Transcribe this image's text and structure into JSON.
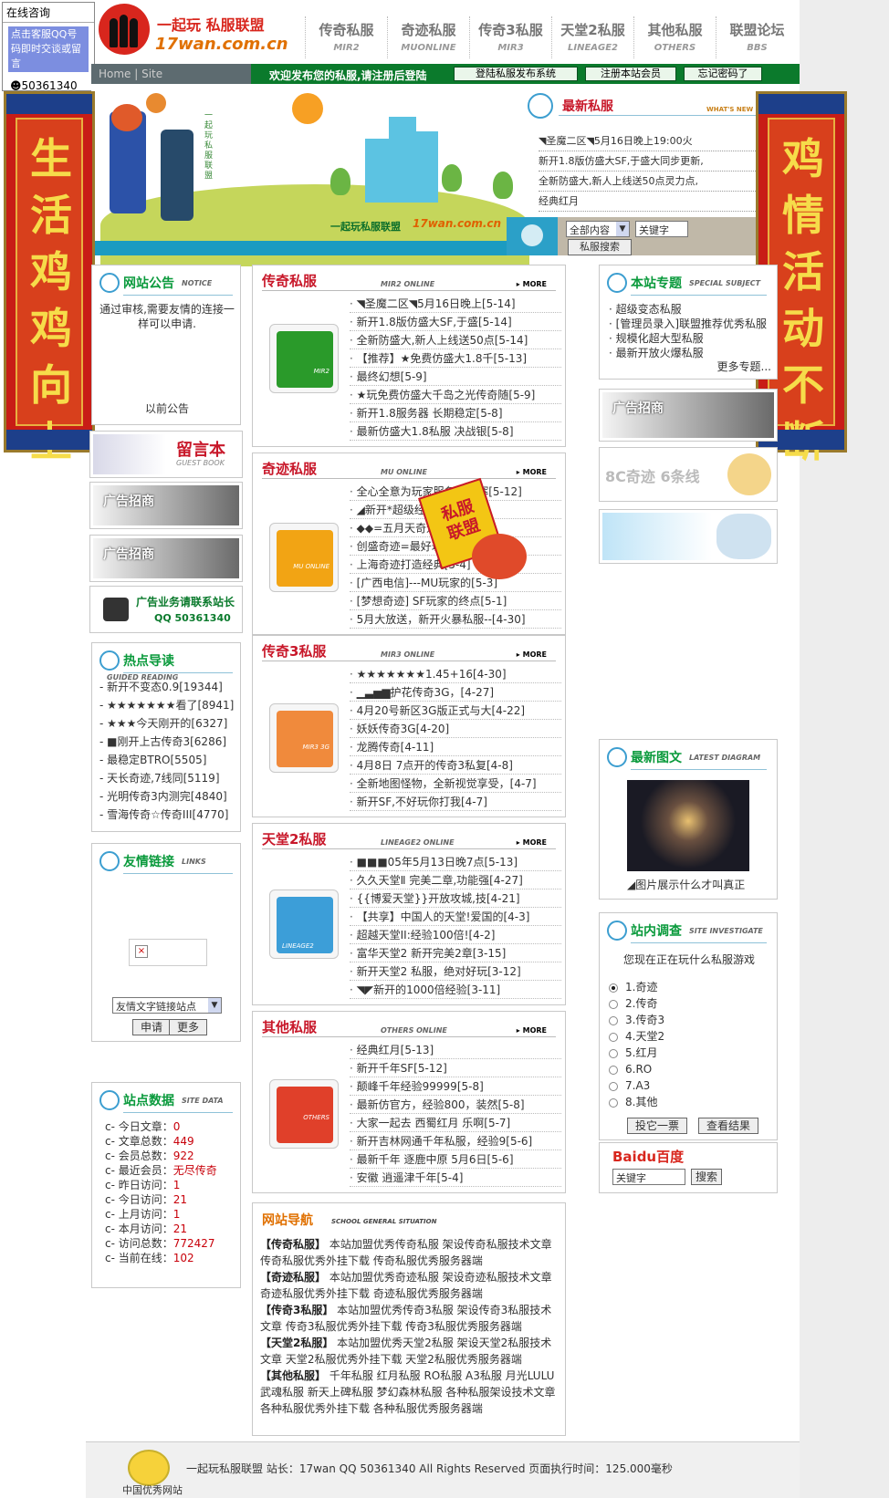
{
  "qq_box": {
    "title": "在线咨询",
    "button": "点击客服QQ号码即时交谈或留言",
    "qq": "50361340"
  },
  "header": {
    "logo_text": "一起玩 私服联盟",
    "logo_url": "17wan.com.cn"
  },
  "topnav": [
    {
      "cn": "传奇私服",
      "en": "MIR2"
    },
    {
      "cn": "奇迹私服",
      "en": "MUONLINE"
    },
    {
      "cn": "传奇3私服",
      "en": "MIR3"
    },
    {
      "cn": "天堂2私服",
      "en": "LINEAGE2"
    },
    {
      "cn": "其他私服",
      "en": "OTHERS"
    },
    {
      "cn": "联盟论坛",
      "en": "BBS"
    }
  ],
  "bar": {
    "home": "Home | Site",
    "welcome": "欢迎发布您的私服,请注册后登陆",
    "btn1": "登陆私服发布系统",
    "btn2": "注册本站会员",
    "btn3": "忘记密码了"
  },
  "banner": {
    "caption": "一起玩私服联盟",
    "url": "17wan.com.cn",
    "side_text": "一起玩私服联盟"
  },
  "latest": {
    "title": "最新私服",
    "en": "WHAT'S NEW",
    "items": [
      "◥圣魔二区◥5月16日晚上19:00火",
      "新开1.8版仿盛大SF,于盛大同步更新,",
      "全新防盛大,新人上线送50点灵力点,",
      "经典红月"
    ]
  },
  "search": {
    "select": "全部内容",
    "input": "关键字",
    "button": "私服搜索"
  },
  "couplet_left": "生活鸡鸡向上",
  "couplet_right": "鸡情活动不断",
  "notice": {
    "title": "网站公告",
    "en": "NOTICE",
    "text": "通过审核,需要友情的连接一样可以申请.",
    "more": "以前公告"
  },
  "guestbook": {
    "title": "留言本",
    "en": "GUEST BOOK"
  },
  "ad_text": "广告招商",
  "ad_contact": {
    "line1": "广告业务请联系站长",
    "line2": "QQ 50361340"
  },
  "hot": {
    "title": "热点导读",
    "en": "GUIDED READING",
    "items": [
      "- 新开不变态0.9[19344]",
      "- ★★★★★★★看了[8941]",
      "- ★★★今天刚开的[6327]",
      "- ■刚开上古传奇3[6286]",
      "- 最稳定BTRO[5505]",
      "- 天长奇迹,7线同[5119]",
      "- 光明传奇3内测完[4840]",
      "- 雪海传奇☆传奇III[4770]"
    ]
  },
  "links": {
    "title": "友情链接",
    "en": "LINKS",
    "select": "友情文字链接站点",
    "btn1": "申请",
    "btn2": "更多"
  },
  "stats": {
    "title": "站点数据",
    "en": "SITE DATA",
    "items": [
      {
        "k": "c- 今日文章：",
        "v": "0"
      },
      {
        "k": "c- 文章总数：",
        "v": "449"
      },
      {
        "k": "c- 会员总数：",
        "v": "922"
      },
      {
        "k": "c- 最近会员：",
        "v": "无尽传奇"
      },
      {
        "k": "c- 昨日访问：",
        "v": "1"
      },
      {
        "k": "c- 今日访问：",
        "v": "21"
      },
      {
        "k": "c- 上月访问：",
        "v": "1"
      },
      {
        "k": "c- 本月访问：",
        "v": "21"
      },
      {
        "k": "c- 访问总数：",
        "v": "772427"
      },
      {
        "k": "c- 当前在线：",
        "v": "102"
      }
    ]
  },
  "sections": [
    {
      "cn": "传奇私服",
      "en": "MIR2 ONLINE",
      "more": "MORE",
      "thumb_label": "MIR2",
      "items": [
        "◥圣魔二区◥5月16日晚上[5-14]",
        "新开1.8版仿盛大SF,于盛[5-14]",
        "全新防盛大,新人上线送50点[5-14]",
        "【推荐】★免费仿盛大1.8千[5-13]",
        "最终幻想[5-9]",
        "★玩免费仿盛大千岛之光传奇随[5-9]",
        "新开1.8服务器 长期稳定[5-8]",
        "最新仿盛大1.8私服 决战银[5-8]"
      ]
    },
    {
      "cn": "奇迹私服",
      "en": "MU ONLINE",
      "more": "MORE",
      "thumb_label": "MU ONLINE",
      "items": [
        "全心全意为玩家服务SF=辉[5-12]",
        "◢新开*超级经典[5-11]",
        "◆◆=五月天奇迹开区[5-11]",
        "创盛奇迹=最好玩的奇迹[5-10]",
        "上海奇迹打造经典[5-4]",
        "[广西电信]---MU玩家的[5-3]",
        "[梦想奇迹] SF玩家的终点[5-1]",
        "5月大放送，新开火暴私服--[4-30]"
      ]
    },
    {
      "cn": "传奇3私服",
      "en": "MIR3 ONLINE",
      "more": "MORE",
      "thumb_label": "MIR3 3G",
      "items": [
        "★★★★★★★1.45+16[4-30]",
        "▁▃▅▆护花传奇3G，[4-27]",
        "4月20号新区3G版正式与大[4-22]",
        "妖妖传奇3G[4-20]",
        "龙腾传奇[4-11]",
        "4月8日 7点开的传奇3私复[4-8]",
        "全新地图怪物，全新视觉享受，[4-7]",
        "新开SF,不好玩你打我[4-7]"
      ]
    },
    {
      "cn": "天堂2私服",
      "en": "LINEAGE2 ONLINE",
      "more": "MORE",
      "thumb_label": "LINEAGE2",
      "items": [
        "■■■05年5月13日晚7点[5-13]",
        "久久天堂Ⅱ 完美二章,功能强[4-27]",
        "{{博爱天堂}}开放攻城,技[4-21]",
        "【共享】中国人的天堂!爱国的[4-3]",
        "超越天堂II:经验100倍![4-2]",
        "富华天堂2 新开完美2章[3-15]",
        "新开天堂2 私服，绝对好玩[3-12]",
        "◥◤新开的1000倍经验[3-11]"
      ]
    },
    {
      "cn": "其他私服",
      "en": "OTHERS ONLINE",
      "more": "MORE",
      "thumb_label": "OTHERS",
      "items": [
        "经典红月[5-13]",
        "新开千年SF[5-12]",
        "颠峰千年经验99999[5-8]",
        "最新仿官方，经验800，装然[5-8]",
        "大家一起去 西蜀红月 乐啊[5-7]",
        "新开吉林网通千年私服，经验9[5-6]",
        "最新千年 逐鹿中原 5月6日[5-6]",
        "安徽 逍遥津千年[5-4]"
      ]
    }
  ],
  "site_nav": {
    "title": "网站导航",
    "en": "SCHOOL GENERAL SITUATION",
    "rows": [
      {
        "b": "【传奇私服】",
        "t": " 本站加盟优秀传奇私服 架设传奇私服技术文章 传奇私服优秀外挂下载 传奇私服优秀服务器端"
      },
      {
        "b": "【奇迹私服】",
        "t": " 本站加盟优秀奇迹私服 架设奇迹私服技术文章 奇迹私服优秀外挂下载 奇迹私服优秀服务器端"
      },
      {
        "b": "【传奇3私服】",
        "t": " 本站加盟优秀传奇3私服 架设传奇3私服技术文章 传奇3私服优秀外挂下载 传奇3私服优秀服务器端"
      },
      {
        "b": "【天堂2私服】",
        "t": " 本站加盟优秀天堂2私服 架设天堂2私服技术文章 天堂2私服优秀外挂下载 天堂2私服优秀服务器端"
      },
      {
        "b": "【其他私服】",
        "t": " 千年私服 红月私服 RO私服 A3私服 月光LULU 武魂私服 新天上碑私服 梦幻森林私服 各种私服架设技术文章 各种私服优秀外挂下载 各种私服优秀服务器端"
      }
    ]
  },
  "topics": {
    "title": "本站专题",
    "en": "SPECIAL SUBJECT",
    "items": [
      "超级变态私服",
      "[管理员录入]联盟推荐优秀私服",
      "规模化超大型私服",
      "最新开放火爆私服"
    ],
    "more": "更多专题..."
  },
  "ad8c": {
    "text": "8C奇迹 6条线"
  },
  "diagram": {
    "title": "最新图文",
    "en": "LATEST DIAGRAM",
    "caption": "◢图片展示什么才叫真正"
  },
  "poll": {
    "title": "站内调查",
    "en": "SITE INVESTIGATE",
    "question": "您现在正在玩什么私服游戏",
    "options": [
      "1.奇迹",
      "2.传奇",
      "3.传奇3",
      "4.天堂2",
      "5.红月",
      "6.RO",
      "7.A3",
      "8.其他"
    ],
    "btn1": "投它一票",
    "btn2": "查看结果"
  },
  "baidu": {
    "logo": "Baidu百度",
    "input": "关键字",
    "btn": "搜索"
  },
  "footer": {
    "text": "一起玩私服联盟 站长：17wan QQ 50361340 All Rights Reserved 页面执行时间：125.000毫秒",
    "badge_caption": "中国优秀网站"
  },
  "stamp": "私服联盟",
  "colors": {
    "green": "#0b7a2c",
    "red": "#c8182a",
    "cyan": "#1b9bc1"
  }
}
